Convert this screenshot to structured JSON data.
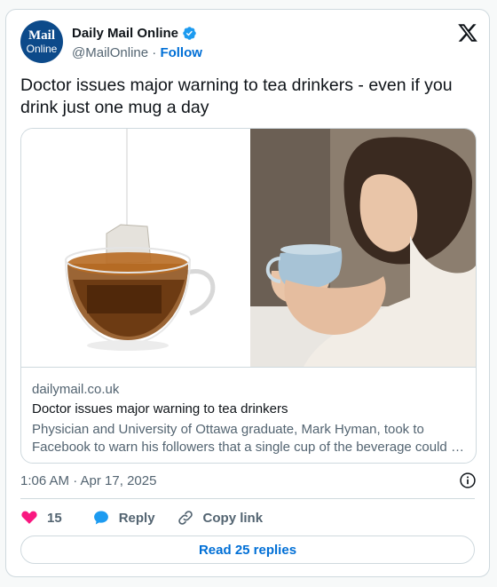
{
  "author": {
    "avatar_line1": "Mail",
    "avatar_line2": "Online",
    "name": "Daily Mail Online",
    "handle": "@MailOnline",
    "separator": "·",
    "follow_label": "Follow"
  },
  "tweet": {
    "text": "Doctor issues major warning to tea drinkers - even if you drink just one mug a day"
  },
  "link_card": {
    "domain": "dailymail.co.uk",
    "title": "Doctor issues major warning to tea drinkers",
    "description_line1": "Physician and University of Ottawa graduate, Mark Hyman, took to",
    "description_line2": "Facebook to warn his followers that a single cup of the beverage could …"
  },
  "meta": {
    "timestamp": "1:06 AM · Apr 17, 2025"
  },
  "actions": {
    "like_count": "15",
    "reply_label": "Reply",
    "copy_link_label": "Copy link"
  },
  "read_replies_label": "Read 25 replies",
  "colors": {
    "accent": "#006fd6",
    "like": "#f91880",
    "verified": "#1d9bf0",
    "avatar_bg": "#0c4a8a"
  }
}
